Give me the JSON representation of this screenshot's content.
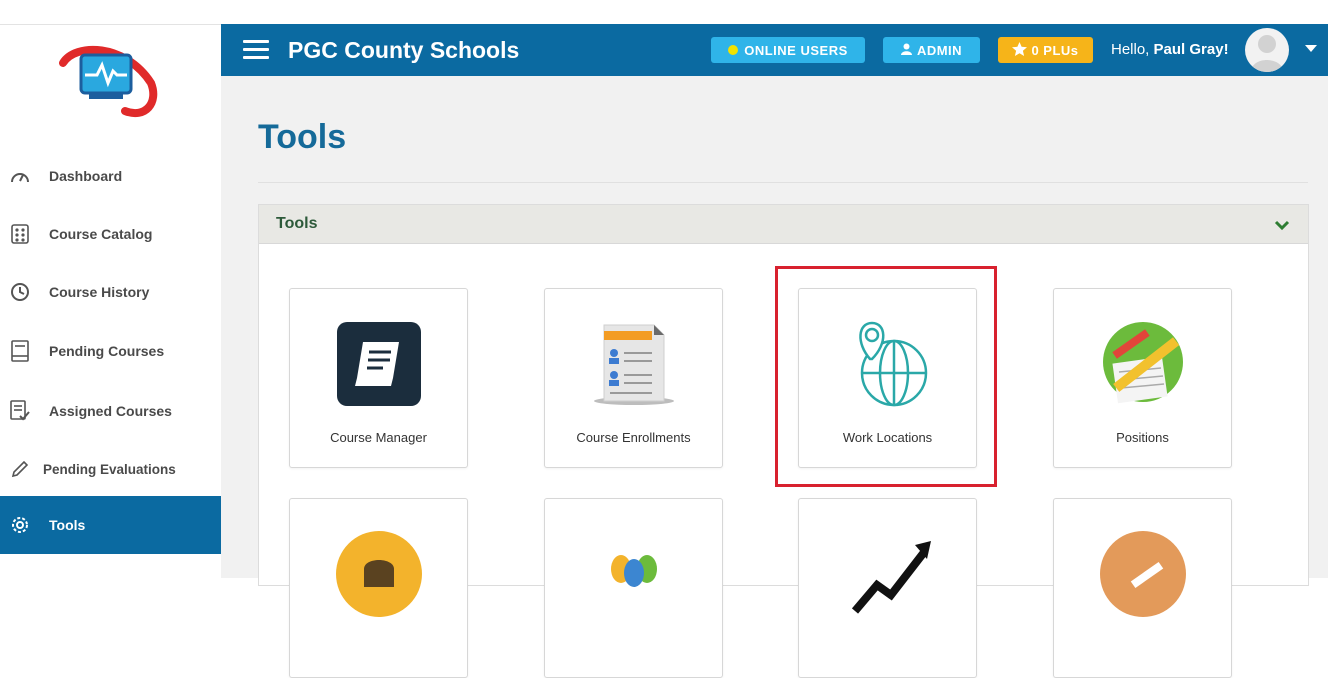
{
  "header": {
    "brand": "PGC County Schools",
    "online_users": "ONLINE USERS",
    "admin": "ADMIN",
    "plus": "0 PLUs",
    "hello_prefix": "Hello,",
    "user_name": "Paul Gray!"
  },
  "sidebar": {
    "items": [
      {
        "label": "Dashboard",
        "icon": "gauge-icon"
      },
      {
        "label": "Course Catalog",
        "icon": "catalog-icon"
      },
      {
        "label": "Course History",
        "icon": "clock-icon"
      },
      {
        "label": "Pending Courses",
        "icon": "book-icon"
      },
      {
        "label": "Assigned Courses",
        "icon": "checklist-icon"
      },
      {
        "label": "Pending Evaluations",
        "icon": "pencil-icon"
      },
      {
        "label": "Tools",
        "icon": "gear-icon",
        "active": true
      }
    ]
  },
  "main": {
    "title": "Tools",
    "panel_title": "Tools",
    "tiles": [
      {
        "label": "Course Manager",
        "icon": "book-app-icon"
      },
      {
        "label": "Course Enrollments",
        "icon": "document-users-icon"
      },
      {
        "label": "Work Locations",
        "icon": "globe-pin-icon"
      },
      {
        "label": "Positions",
        "icon": "pencil-ruler-icon"
      },
      {
        "label": "",
        "icon": "bell-icon"
      },
      {
        "label": "",
        "icon": "balloons-icon"
      },
      {
        "label": "",
        "icon": "trend-arrow-icon"
      },
      {
        "label": "",
        "icon": "key-icon"
      }
    ]
  },
  "colors": {
    "primary": "#0b6aa1",
    "cyan_pill": "#2fb4e9",
    "gold_pill": "#f6b419",
    "highlight": "#d8212f",
    "panel_title": "#2d5a3a"
  }
}
